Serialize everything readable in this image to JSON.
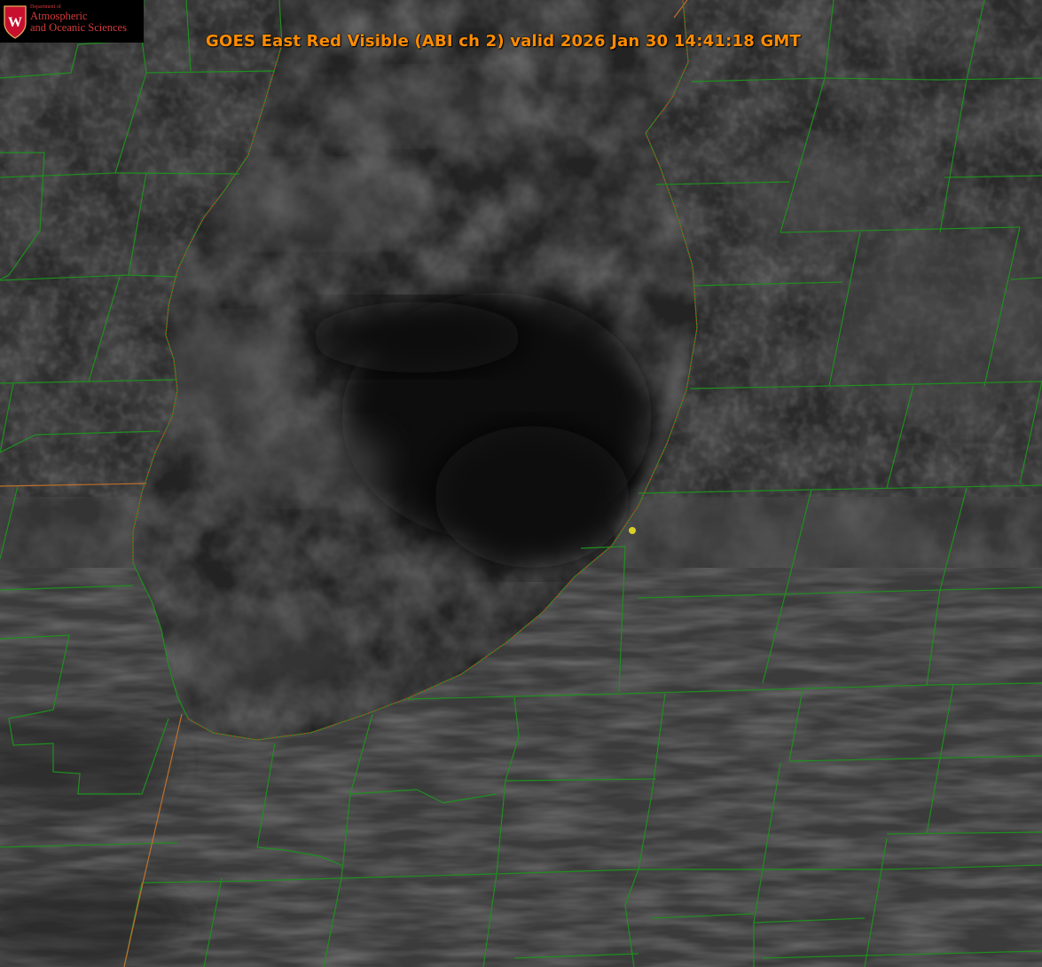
{
  "title": "GOES East Red Visible (ABI ch 2) valid 2026 Jan 30 14:41:18 GMT",
  "logo": {
    "line_small": "Department of",
    "line_1": "Atmospheric",
    "line_2": "and Oceanic Sciences",
    "emblem_letter": "W"
  },
  "colors": {
    "title": "#ff8c00",
    "county_lines": "#1f8f1f",
    "state_lines": "#c0702a",
    "shoreline": "#e03030",
    "marker": "#d8cf28",
    "logo_red": "#d63a3a"
  },
  "icons": [
    "uw-crest-icon",
    "location-marker-icon"
  ]
}
